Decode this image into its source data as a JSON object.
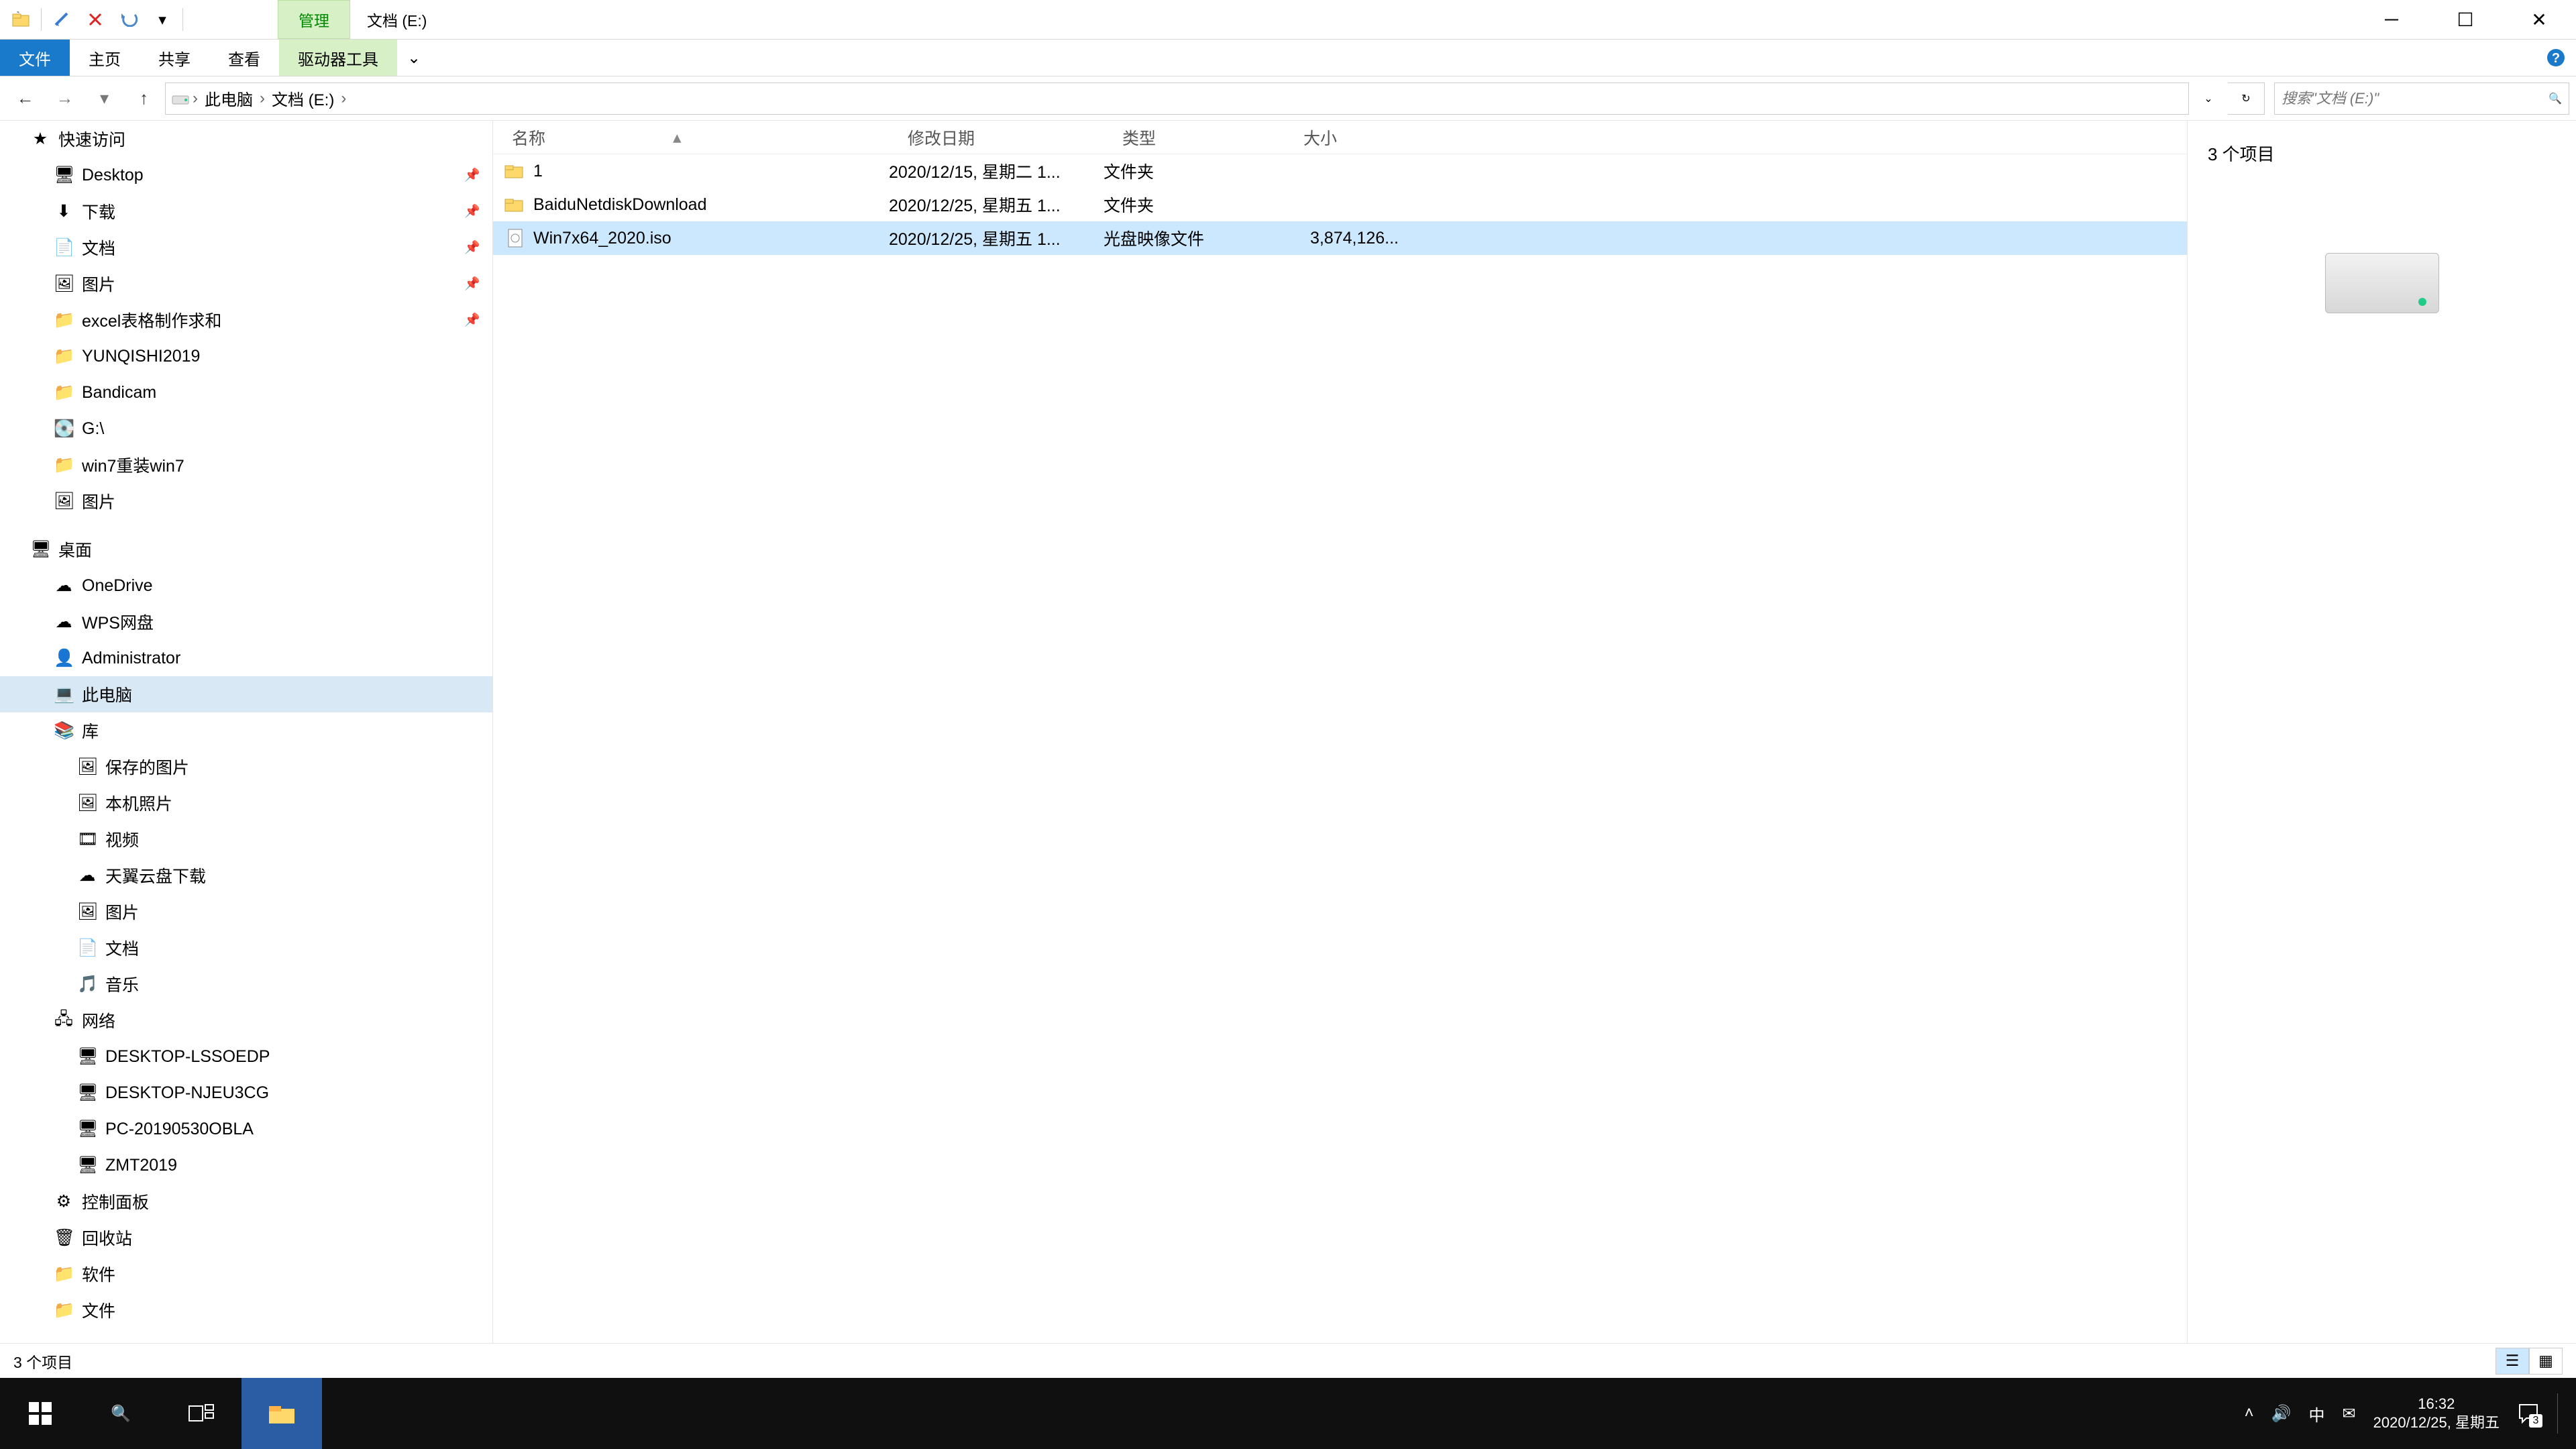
{
  "title_context_tab": "管理",
  "title_tab": "文档 (E:)",
  "ribbon": {
    "file": "文件",
    "home": "主页",
    "share": "共享",
    "view": "查看",
    "drive_tools": "驱动器工具"
  },
  "breadcrumb": {
    "root": "此电脑",
    "path": "文档 (E:)"
  },
  "search_placeholder": "搜索\"文档 (E:)\"",
  "sidebar": {
    "quick_access": "快速访问",
    "desktop": "Desktop",
    "downloads": "下载",
    "documents": "文档",
    "pictures": "图片",
    "excel_help": "excel表格制作求和",
    "yunqishi": "YUNQISHI2019",
    "bandicam": "Bandicam",
    "g_drive": "G:\\",
    "win7_reinstall": "win7重装win7",
    "pictures2": "图片",
    "desktop_zh": "桌面",
    "onedrive": "OneDrive",
    "wps": "WPS网盘",
    "administrator": "Administrator",
    "this_pc": "此电脑",
    "libraries": "库",
    "saved_pics": "保存的图片",
    "local_photos": "本机照片",
    "videos": "视频",
    "tianyi": "天翼云盘下载",
    "lib_pictures": "图片",
    "lib_docs": "文档",
    "music": "音乐",
    "network": "网络",
    "net1": "DESKTOP-LSSOEDP",
    "net2": "DESKTOP-NJEU3CG",
    "net3": "PC-20190530OBLA",
    "net4": "ZMT2019",
    "control_panel": "控制面板",
    "recycle": "回收站",
    "software": "软件",
    "files": "文件"
  },
  "columns": {
    "name": "名称",
    "date": "修改日期",
    "type": "类型",
    "size": "大小"
  },
  "files": [
    {
      "name": "1",
      "date": "2020/12/15, 星期二 1...",
      "type": "文件夹",
      "size": "",
      "kind": "folder",
      "selected": false
    },
    {
      "name": "BaiduNetdiskDownload",
      "date": "2020/12/25, 星期五 1...",
      "type": "文件夹",
      "size": "",
      "kind": "folder",
      "selected": false
    },
    {
      "name": "Win7x64_2020.iso",
      "date": "2020/12/25, 星期五 1...",
      "type": "光盘映像文件",
      "size": "3,874,126...",
      "kind": "iso",
      "selected": true
    }
  ],
  "preview_header": "3 个项目",
  "status": "3 个项目",
  "taskbar": {
    "time": "16:32",
    "date": "2020/12/25, 星期五",
    "ime": "中",
    "notif_count": "3"
  }
}
